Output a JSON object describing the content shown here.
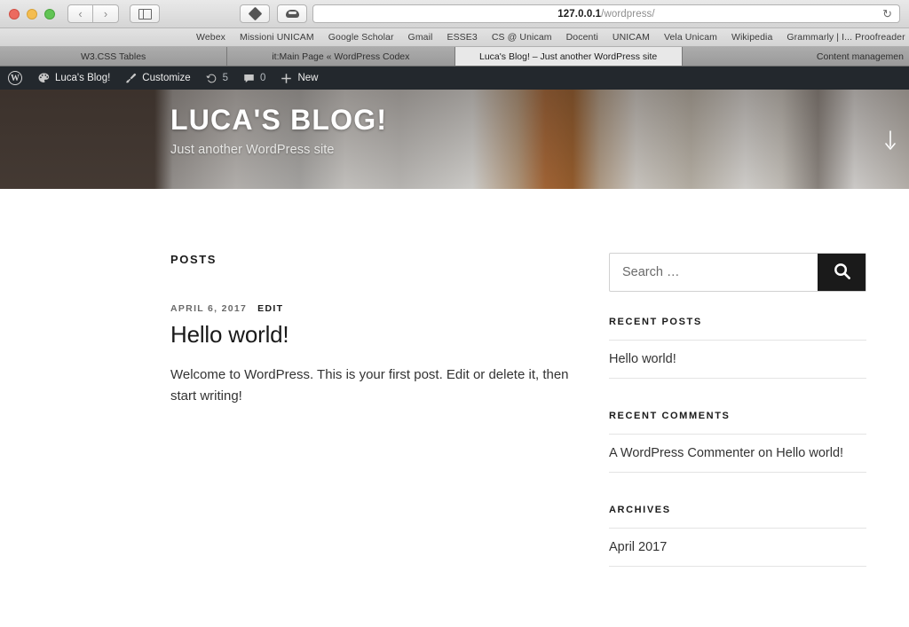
{
  "browser": {
    "window_controls": [
      "close",
      "minimize",
      "maximize"
    ],
    "back_label": "‹",
    "forward_label": "›",
    "sidebar_icon": "sidebar-icon",
    "extensions": [
      "diamond-extension-icon",
      "cloud-extension-icon"
    ],
    "address": {
      "host": "127.0.0.1",
      "path": "/wordpress/",
      "full": "127.0.0.1/wordpress/",
      "reload_label": "↻"
    },
    "bookmarks": [
      "Webex",
      "Missioni UNICAM",
      "Google Scholar",
      "Gmail",
      "ESSE3",
      "CS @ Unicam",
      "Docenti",
      "UNICAM",
      "Vela Unicam",
      "Wikipedia",
      "Grammarly | I... Proofreader"
    ],
    "tabs": [
      {
        "label": "W3.CSS Tables",
        "active": false
      },
      {
        "label": "it:Main Page « WordPress Codex",
        "active": false
      },
      {
        "label": "Luca's Blog! – Just another WordPress site",
        "active": true
      },
      {
        "label": "Content managemen",
        "active": false
      }
    ]
  },
  "adminbar": {
    "background": "#23282d",
    "logo": "wordpress-logo",
    "site_name": "Luca's Blog!",
    "customize": "Customize",
    "updates_count": "5",
    "comments_count": "0",
    "new_label": "New"
  },
  "site": {
    "title": "LUCA'S BLOG!",
    "description": "Just another WordPress site",
    "scroll_hint": "scroll-down-arrow"
  },
  "main": {
    "section_label": "POSTS",
    "posts": [
      {
        "date": "APRIL 6, 2017",
        "edit_label": "EDIT",
        "title": "Hello world!",
        "excerpt": "Welcome to WordPress. This is your first post. Edit or delete it, then start writing!"
      }
    ]
  },
  "sidebar": {
    "search": {
      "placeholder": "Search …",
      "value": "",
      "submit_icon": "search-icon",
      "button_color": "#1a1a1a"
    },
    "widgets": [
      {
        "title": "RECENT POSTS",
        "items": [
          "Hello world!"
        ]
      },
      {
        "title": "RECENT COMMENTS",
        "items": [
          "A WordPress Commenter on Hello world!"
        ]
      },
      {
        "title": "ARCHIVES",
        "items": [
          "April 2017"
        ]
      }
    ]
  }
}
